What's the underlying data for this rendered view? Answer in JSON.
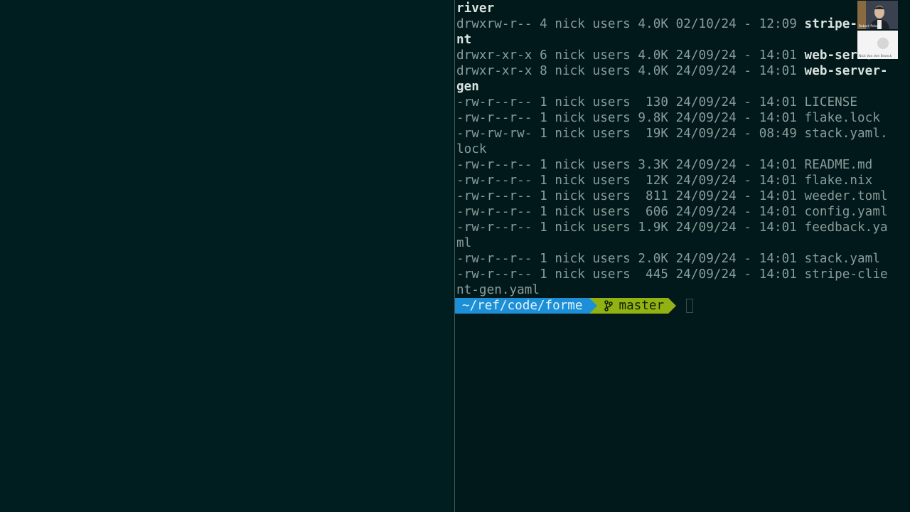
{
  "terminal": {
    "lines": [
      [
        {
          "t": "river",
          "c": "b"
        }
      ],
      [
        {
          "t": "drwxrw-r-- 4 nick users 4.0K 02/10/24 - 12:09 "
        },
        {
          "t": "stripe-clie",
          "c": "b"
        }
      ],
      [
        {
          "t": "nt",
          "c": "b"
        }
      ],
      [
        {
          "t": "drwxr-xr-x 6 nick users 4.0K 24/09/24 - 14:01 "
        },
        {
          "t": "web-server",
          "c": "b"
        }
      ],
      [
        {
          "t": "drwxr-xr-x 8 nick users 4.0K 24/09/24 - 14:01 "
        },
        {
          "t": "web-server-",
          "c": "b"
        }
      ],
      [
        {
          "t": "gen",
          "c": "b"
        }
      ],
      [
        {
          "t": "-rw-r--r-- 1 nick users  130 24/09/24 - 14:01 LICENSE"
        }
      ],
      [
        {
          "t": "-rw-r--r-- 1 nick users 9.8K 24/09/24 - 14:01 flake.lock"
        }
      ],
      [
        {
          "t": "-rw-rw-rw- 1 nick users  19K 24/09/24 - 08:49 stack.yaml."
        }
      ],
      [
        {
          "t": "lock"
        }
      ],
      [
        {
          "t": "-rw-r--r-- 1 nick users 3.3K 24/09/24 - 14:01 README.md"
        }
      ],
      [
        {
          "t": "-rw-r--r-- 1 nick users  12K 24/09/24 - 14:01 flake.nix"
        }
      ],
      [
        {
          "t": "-rw-r--r-- 1 nick users  811 24/09/24 - 14:01 weeder.toml"
        }
      ],
      [
        {
          "t": "-rw-r--r-- 1 nick users  606 24/09/24 - 14:01 config.yaml"
        }
      ],
      [
        {
          "t": "-rw-r--r-- 1 nick users 1.9K 24/09/24 - 14:01 feedback.ya"
        }
      ],
      [
        {
          "t": "ml"
        }
      ],
      [
        {
          "t": "-rw-r--r-- 1 nick users 2.0K 24/09/24 - 14:01 stack.yaml"
        }
      ],
      [
        {
          "t": "-rw-r--r-- 1 nick users  445 24/09/24 - 14:01 stripe-clie"
        }
      ],
      [
        {
          "t": "nt-gen.yaml"
        }
      ]
    ],
    "prompt": {
      "directory": "~/ref/code/forme",
      "branch": "master",
      "branch_icon": "git-branch-icon"
    }
  },
  "video_tiles": [
    {
      "name": "Robert Pelsek"
    },
    {
      "name": "Nick Van den Broeck"
    }
  ],
  "colors": {
    "background": "#01191a",
    "prompt_dir": "#1d8fd6",
    "prompt_git": "#92b214"
  }
}
